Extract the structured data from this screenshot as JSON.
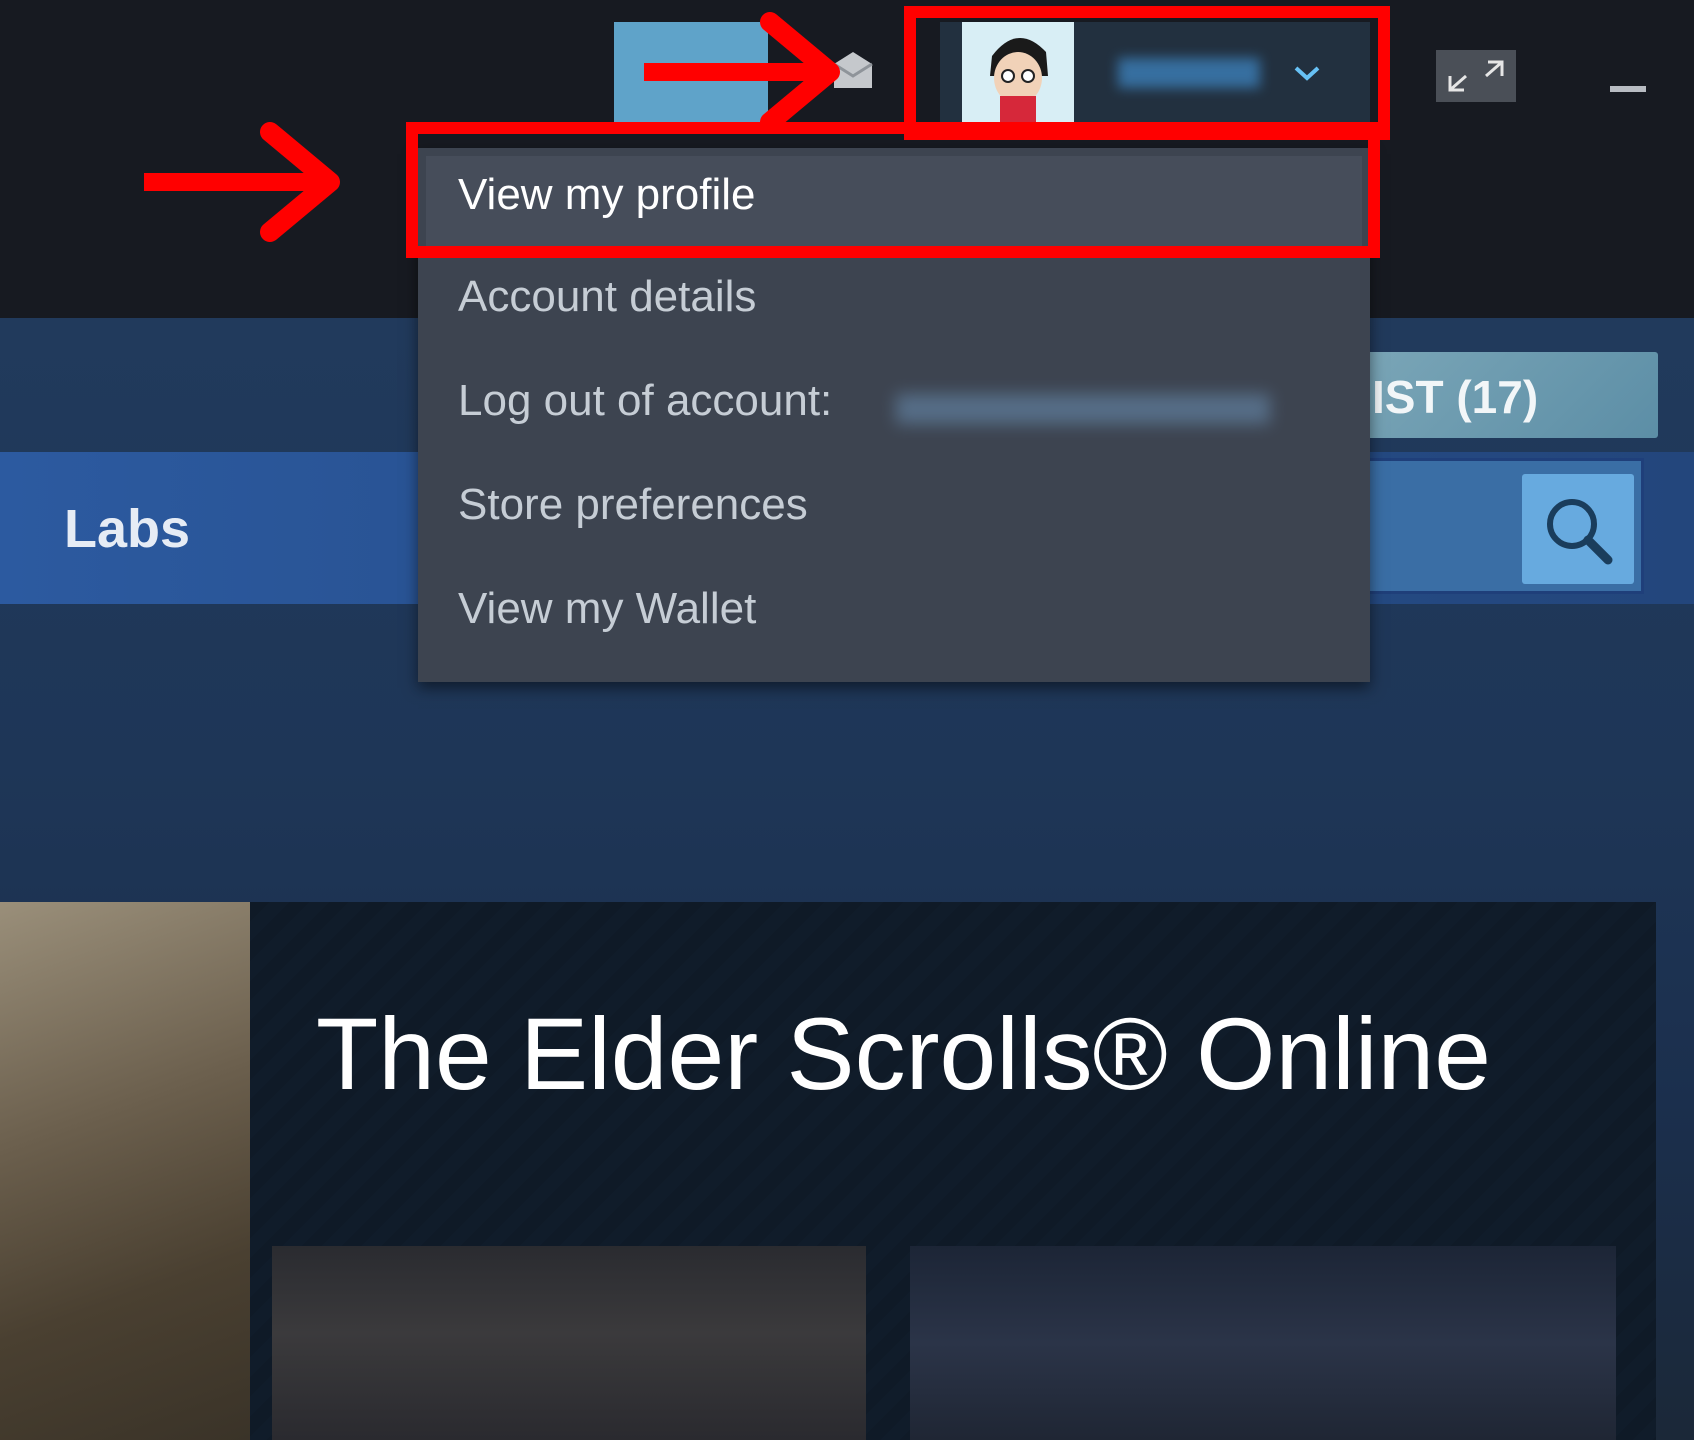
{
  "header": {
    "account_menu": {
      "items": [
        {
          "label": "View my profile"
        },
        {
          "label": "Account details"
        },
        {
          "label": "Log out of account:"
        },
        {
          "label": "Store preferences"
        },
        {
          "label": "View my Wallet"
        }
      ]
    }
  },
  "store_nav": {
    "labs_label": "Labs",
    "wishlist_label": "IST (17)"
  },
  "feature": {
    "title": "The Elder Scrolls® Online"
  },
  "colors": {
    "highlight": "#ff0000",
    "topbar": "#171a21",
    "menu_bg": "#3d4450"
  },
  "icons": [
    "envelope-icon",
    "chevron-down-icon",
    "fullscreen-icon",
    "minimize-icon",
    "search-icon",
    "avatar"
  ]
}
